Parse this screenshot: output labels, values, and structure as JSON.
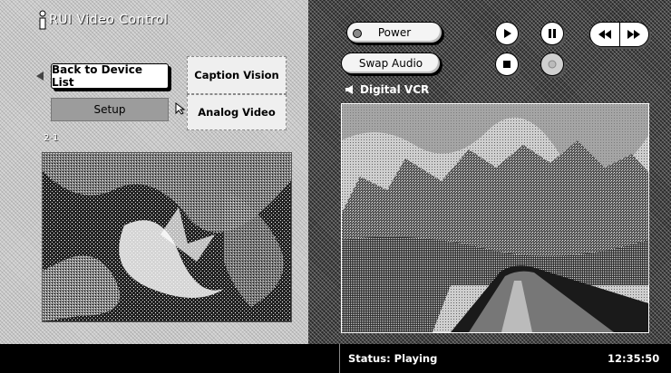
{
  "app": {
    "title": "RUI Video Control"
  },
  "left": {
    "back_button_label": "Back to Device List",
    "setup_button_label": "Setup",
    "caption_vision_label": "Caption Vision",
    "analog_video_label": "Analog Video",
    "channel_label": "2-1"
  },
  "right": {
    "power_label": "Power",
    "swap_audio_label": "Swap Audio",
    "device_label": "Digital VCR",
    "transport_icons": [
      "play-icon",
      "pause-icon",
      "stop-icon",
      "record-icon",
      "rewind-icon",
      "fast-forward-icon"
    ]
  },
  "status": {
    "text": "Status: Playing",
    "time": "12:35:50"
  },
  "colors": {
    "status_bar": "#000000",
    "right_panel": "#2a2a2a",
    "left_panel": "#d6d6d6"
  }
}
